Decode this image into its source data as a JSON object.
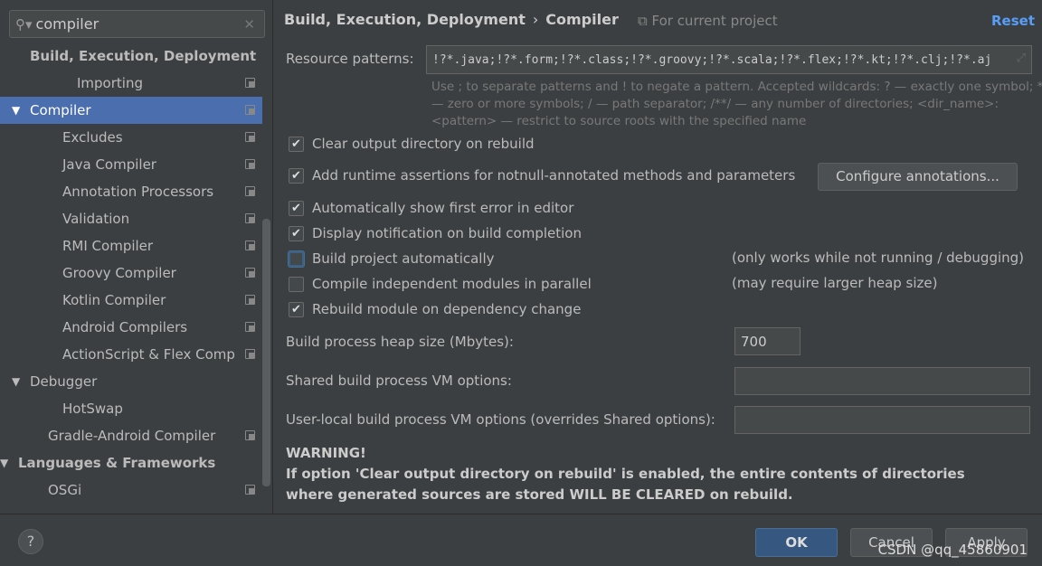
{
  "search": {
    "value": "compiler"
  },
  "tree": [
    {
      "label": "Build, Execution, Deployment",
      "indent": 33,
      "bold": true,
      "arrow": "",
      "proj": false
    },
    {
      "label": "Importing",
      "indent": 85,
      "proj": true
    },
    {
      "label": "Compiler",
      "indent": 33,
      "arrow": "▼",
      "proj": true,
      "selected": true
    },
    {
      "label": "Excludes",
      "indent": 69,
      "proj": true
    },
    {
      "label": "Java Compiler",
      "indent": 69,
      "proj": true
    },
    {
      "label": "Annotation Processors",
      "indent": 69,
      "proj": true
    },
    {
      "label": "Validation",
      "indent": 69,
      "proj": true
    },
    {
      "label": "RMI Compiler",
      "indent": 69,
      "proj": true
    },
    {
      "label": "Groovy Compiler",
      "indent": 69,
      "proj": true
    },
    {
      "label": "Kotlin Compiler",
      "indent": 69,
      "proj": true
    },
    {
      "label": "Android Compilers",
      "indent": 69,
      "proj": true
    },
    {
      "label": "ActionScript & Flex Comp",
      "indent": 69,
      "proj": true
    },
    {
      "label": "Debugger",
      "indent": 33,
      "arrow": "▼",
      "proj": false
    },
    {
      "label": "HotSwap",
      "indent": 69,
      "proj": false
    },
    {
      "label": "Gradle-Android Compiler",
      "indent": 53,
      "proj": true
    },
    {
      "label": "Languages & Frameworks",
      "indent": 15,
      "arrow": "▼",
      "bold": true,
      "proj": false
    },
    {
      "label": "OSGi",
      "indent": 53,
      "proj": true
    }
  ],
  "header": {
    "crumb1": "Build, Execution, Deployment",
    "sep": "›",
    "crumb2": "Compiler",
    "for_project": "For current project",
    "reset": "Reset"
  },
  "resource": {
    "label": "Resource patterns:",
    "value": "!?*.java;!?*.form;!?*.class;!?*.groovy;!?*.scala;!?*.flex;!?*.kt;!?*.clj;!?*.aj"
  },
  "hint": "Use ; to separate patterns and ! to negate a pattern. Accepted wildcards: ? — exactly one symbol; * — zero or more symbols; / — path separator; /**/ — any number of directories; <dir_name>:<pattern> — restrict to source roots with the specified name",
  "options": [
    {
      "label": "Clear output directory on rebuild",
      "checked": true
    },
    {
      "label": "Add runtime assertions for notnull-annotated methods and parameters",
      "checked": true
    },
    {
      "label": "Automatically show first error in editor",
      "checked": true
    },
    {
      "label": "Display notification on build completion",
      "checked": true
    },
    {
      "label": "Build project automatically",
      "checked": false,
      "note": "(only works while not running / debugging)"
    },
    {
      "label": "Compile independent modules in parallel",
      "checked": false,
      "note": "(may require larger heap size)"
    },
    {
      "label": "Rebuild module on dependency change",
      "checked": true
    }
  ],
  "configure_button": "Configure annotations...",
  "heap": {
    "label": "Build process heap size (Mbytes):",
    "value": "700"
  },
  "shared_vm": {
    "label": "Shared build process VM options:",
    "value": ""
  },
  "user_vm": {
    "label": "User-local build process VM options (overrides Shared options):",
    "value": ""
  },
  "warning": {
    "title": "WARNING!",
    "text": "If option 'Clear output directory on rebuild' is enabled, the entire contents of directories where generated sources are stored WILL BE CLEARED on rebuild."
  },
  "footer": {
    "help": "?",
    "ok": "OK",
    "cancel": "Cancel",
    "apply": "Apply",
    "watermark": "CSDN @qq_45860901"
  },
  "colors": {
    "selection": "#4b6eaf",
    "ok": "#365880",
    "link": "#589df6"
  }
}
